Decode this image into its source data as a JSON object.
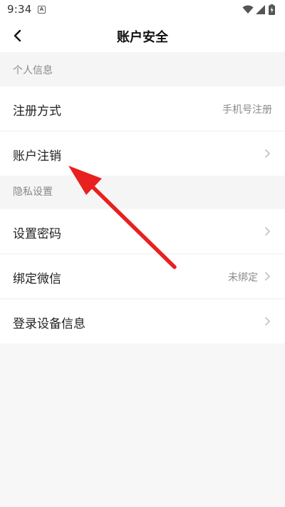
{
  "status_bar": {
    "time": "9:34",
    "app_badge": "A",
    "icons": [
      "app-notification-icon",
      "wifi-icon",
      "signal-icon",
      "battery-charging-icon"
    ]
  },
  "header": {
    "title": "账户安全",
    "back_icon": "chevron-left-icon"
  },
  "sections": [
    {
      "title": "个人信息",
      "items": [
        {
          "label": "注册方式",
          "value": "手机号注册",
          "chevron": false
        },
        {
          "label": "账户注销",
          "value": "",
          "chevron": true
        }
      ]
    },
    {
      "title": "隐私设置",
      "items": [
        {
          "label": "设置密码",
          "value": "",
          "chevron": true
        },
        {
          "label": "绑定微信",
          "value": "未绑定",
          "chevron": true
        },
        {
          "label": "登录设备信息",
          "value": "",
          "chevron": true
        }
      ]
    }
  ],
  "colors": {
    "annotation_arrow": "#e8201f",
    "page_background": "#f7f7f7",
    "row_background": "#ffffff",
    "secondary_text": "#8a8a8a"
  }
}
